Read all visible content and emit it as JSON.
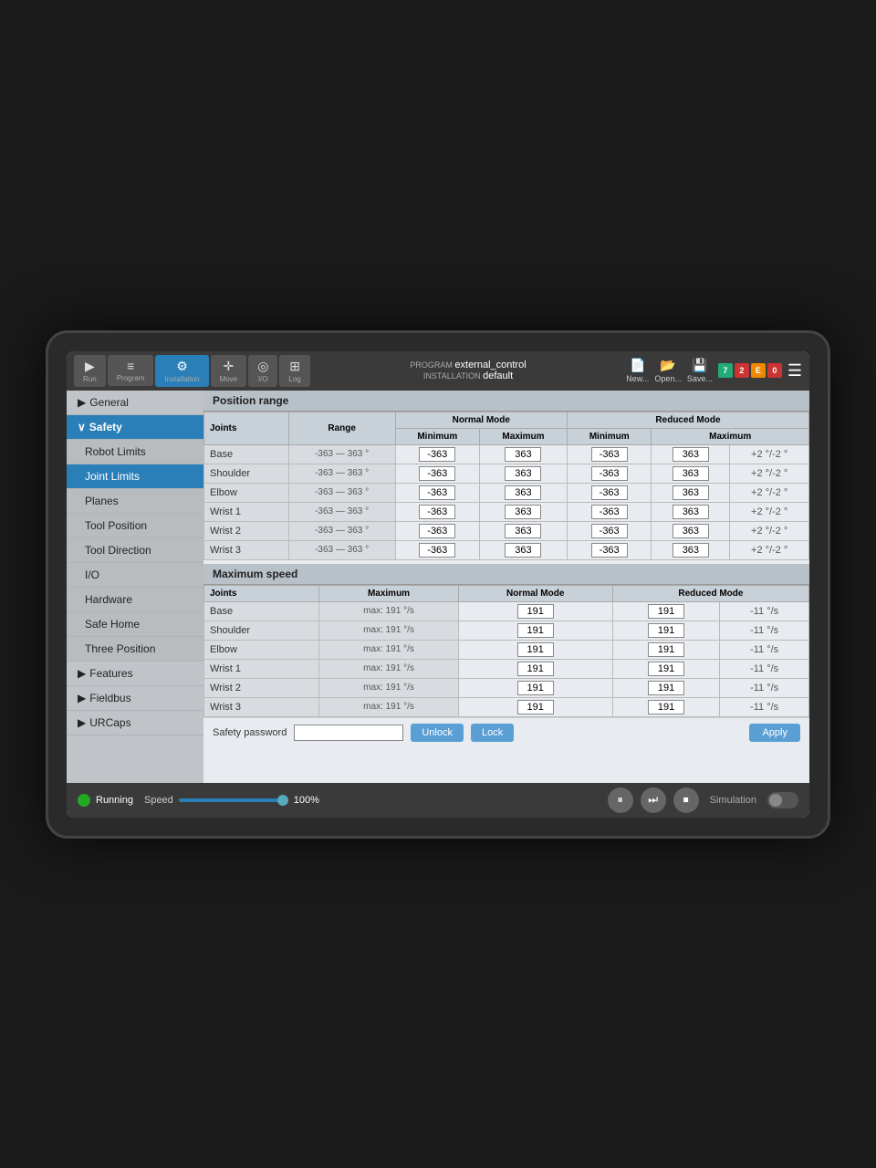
{
  "topbar": {
    "nav_items": [
      {
        "id": "run",
        "icon": "▶",
        "label": "Run"
      },
      {
        "id": "program",
        "icon": "≡",
        "label": "Program"
      },
      {
        "id": "installation",
        "icon": "⚙",
        "label": "Installation",
        "active": true
      },
      {
        "id": "move",
        "icon": "✛",
        "label": "Move"
      },
      {
        "id": "io",
        "icon": "◎",
        "label": "I/O"
      },
      {
        "id": "log",
        "icon": "⊞",
        "label": "Log"
      }
    ],
    "program_label": "PROGRAM",
    "program_name": "external_control",
    "installation_label": "INSTALLATION",
    "installation_name": "default",
    "actions": [
      {
        "id": "new",
        "icon": "📄",
        "label": "New..."
      },
      {
        "id": "open",
        "icon": "📂",
        "label": "Open..."
      },
      {
        "id": "save",
        "icon": "💾",
        "label": "Save..."
      }
    ],
    "badges": [
      {
        "label": "7",
        "color": "green"
      },
      {
        "label": "2",
        "color": "red"
      },
      {
        "label": "E",
        "color": "orange"
      },
      {
        "label": "0",
        "color": "red"
      }
    ]
  },
  "sidebar": {
    "items": [
      {
        "id": "general",
        "label": "General",
        "type": "expandable",
        "expanded": false
      },
      {
        "id": "safety",
        "label": "Safety",
        "type": "expanded",
        "active": true
      },
      {
        "id": "robot-limits",
        "label": "Robot Limits",
        "type": "sub"
      },
      {
        "id": "joint-limits",
        "label": "Joint Limits",
        "type": "sub",
        "active": true
      },
      {
        "id": "planes",
        "label": "Planes",
        "type": "sub"
      },
      {
        "id": "tool-position",
        "label": "Tool Position",
        "type": "sub"
      },
      {
        "id": "tool-direction",
        "label": "Tool Direction",
        "type": "sub"
      },
      {
        "id": "io",
        "label": "I/O",
        "type": "sub"
      },
      {
        "id": "hardware",
        "label": "Hardware",
        "type": "sub"
      },
      {
        "id": "safe-home",
        "label": "Safe Home",
        "type": "sub"
      },
      {
        "id": "three-position",
        "label": "Three Position",
        "type": "sub"
      },
      {
        "id": "features",
        "label": "Features",
        "type": "expandable"
      },
      {
        "id": "fieldbus",
        "label": "Fieldbus",
        "type": "expandable"
      },
      {
        "id": "urcaps",
        "label": "URCaps",
        "type": "expandable"
      }
    ]
  },
  "position_range": {
    "title": "Position range",
    "columns": {
      "joints": "Joints",
      "range": "Range",
      "normal_mode": "Normal Mode",
      "reduced_mode": "Reduced Mode",
      "minimum": "Minimum",
      "maximum": "Maximum"
    },
    "rows": [
      {
        "joint": "Base",
        "range": "-363 — 363 °",
        "nm_min": "-363",
        "nm_max": "363",
        "rm_min": "-363",
        "rm_max": "363",
        "suffix": "+2 °/-2 °"
      },
      {
        "joint": "Shoulder",
        "range": "-363 — 363 °",
        "nm_min": "-363",
        "nm_max": "363",
        "rm_min": "-363",
        "rm_max": "363",
        "suffix": "+2 °/-2 °"
      },
      {
        "joint": "Elbow",
        "range": "-363 — 363 °",
        "nm_min": "-363",
        "nm_max": "363",
        "rm_min": "-363",
        "rm_max": "363",
        "suffix": "+2 °/-2 °"
      },
      {
        "joint": "Wrist 1",
        "range": "-363 — 363 °",
        "nm_min": "-363",
        "nm_max": "363",
        "rm_min": "-363",
        "rm_max": "363",
        "suffix": "+2 °/-2 °"
      },
      {
        "joint": "Wrist 2",
        "range": "-363 — 363 °",
        "nm_min": "-363",
        "nm_max": "363",
        "rm_min": "-363",
        "rm_max": "363",
        "suffix": "+2 °/-2 °"
      },
      {
        "joint": "Wrist 3",
        "range": "-363 — 363 °",
        "nm_min": "-363",
        "nm_max": "363",
        "rm_min": "-363",
        "rm_max": "363",
        "suffix": "+2 °/-2 °"
      }
    ]
  },
  "maximum_speed": {
    "title": "Maximum speed",
    "columns": {
      "joints": "Joints",
      "maximum": "Maximum",
      "normal_mode": "Normal Mode",
      "reduced_mode": "Reduced Mode"
    },
    "rows": [
      {
        "joint": "Base",
        "max_label": "max: 191 °/s",
        "nm": "191",
        "rm": "191",
        "suffix": "-11 °/s"
      },
      {
        "joint": "Shoulder",
        "max_label": "max: 191 °/s",
        "nm": "191",
        "rm": "191",
        "suffix": "-11 °/s"
      },
      {
        "joint": "Elbow",
        "max_label": "max: 191 °/s",
        "nm": "191",
        "rm": "191",
        "suffix": "-11 °/s"
      },
      {
        "joint": "Wrist 1",
        "max_label": "max: 191 °/s",
        "nm": "191",
        "rm": "191",
        "suffix": "-11 °/s"
      },
      {
        "joint": "Wrist 2",
        "max_label": "max: 191 °/s",
        "nm": "191",
        "rm": "191",
        "suffix": "-11 °/s"
      },
      {
        "joint": "Wrist 3",
        "max_label": "max: 191 °/s",
        "nm": "191",
        "rm": "191",
        "suffix": "-11 °/s"
      }
    ]
  },
  "password": {
    "label": "Safety password",
    "unlock_btn": "Unlock",
    "lock_btn": "Lock",
    "apply_btn": "Apply"
  },
  "bottombar": {
    "status": "Running",
    "speed_label": "Speed",
    "speed_pct": "100%",
    "simulation_label": "Simulation"
  }
}
